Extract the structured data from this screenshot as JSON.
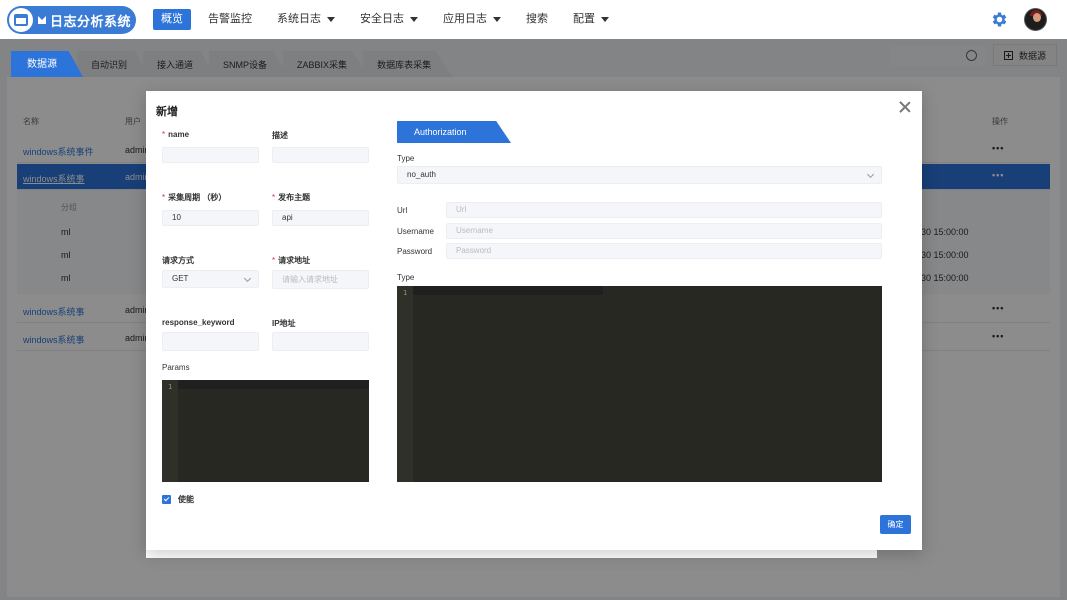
{
  "header": {
    "app_title": "日志分析系统",
    "nav": [
      {
        "label": "概览",
        "active": true,
        "dropdown": false
      },
      {
        "label": "告警监控",
        "active": false,
        "dropdown": false
      },
      {
        "label": "系统日志",
        "active": false,
        "dropdown": true
      },
      {
        "label": "安全日志",
        "active": false,
        "dropdown": true
      },
      {
        "label": "应用日志",
        "active": false,
        "dropdown": true
      },
      {
        "label": "搜索",
        "active": false,
        "dropdown": false
      },
      {
        "label": "配置",
        "active": false,
        "dropdown": true
      }
    ],
    "icons": {
      "settings": "gear-icon",
      "user": "avatar"
    }
  },
  "page": {
    "tabs": [
      "数据源",
      "自动识别",
      "接入通道",
      "SNMP设备",
      "ZABBIX采集",
      "数据库表采集"
    ],
    "add_button": "数据源",
    "table": {
      "headers": {
        "name": "名称",
        "user": "用户",
        "actions": "操作"
      },
      "rows": [
        {
          "name": "windows系统事件",
          "user": "admin"
        },
        {
          "name": "windows系统事",
          "user": "admin"
        },
        {
          "name": "windows系统事",
          "user": "admin"
        },
        {
          "name": "windows系统事",
          "user": "admin"
        }
      ],
      "more": "•••"
    },
    "subtable": {
      "header": "分组",
      "rows": [
        {
          "group": "ml",
          "time": "30 15:00:00"
        },
        {
          "group": "ml",
          "time": "30 15:00:00"
        },
        {
          "group": "ml",
          "time": "30 15:00:00"
        }
      ]
    }
  },
  "modal": {
    "title": "新增",
    "fields": {
      "name_label": "name",
      "desc_label": "描述",
      "period_label": "采集周期 （秒）",
      "period_value": "10",
      "topic_label": "发布主题",
      "topic_value": "api",
      "method_label": "请求方式",
      "method_value": "GET",
      "url_label": "请求地址",
      "url_placeholder": "请输入请求地址",
      "keyword_label": "response_keyword",
      "ip_label": "IP地址",
      "params_label": "Params",
      "enable_label": "使能"
    },
    "auth": {
      "tab": "Authorization",
      "type_label": "Type",
      "type_value": "no_auth",
      "url_label": "Url",
      "url_placeholder": "Url",
      "username_label": "Username",
      "username_placeholder": "Username",
      "password_label": "Password",
      "password_placeholder": "Password",
      "body_type_label": "Type"
    },
    "editor_line": "1",
    "ok_button": "确定"
  }
}
